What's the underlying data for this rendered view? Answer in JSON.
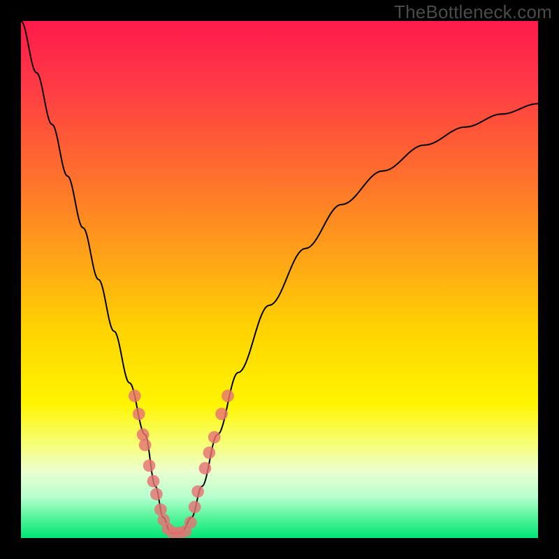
{
  "watermark": "TheBottleneck.com",
  "chart_data": {
    "type": "line",
    "title": "",
    "xlabel": "",
    "ylabel": "",
    "xlim": [
      0,
      100
    ],
    "ylim": [
      0,
      100
    ],
    "background_gradient": {
      "stops": [
        {
          "offset": 0.0,
          "color": "#ff1a4b"
        },
        {
          "offset": 0.12,
          "color": "#ff3945"
        },
        {
          "offset": 0.28,
          "color": "#ff6a2f"
        },
        {
          "offset": 0.44,
          "color": "#ff9e1a"
        },
        {
          "offset": 0.6,
          "color": "#ffd400"
        },
        {
          "offset": 0.74,
          "color": "#fff500"
        },
        {
          "offset": 0.82,
          "color": "#f6ff7a"
        },
        {
          "offset": 0.87,
          "color": "#ecffcf"
        },
        {
          "offset": 0.92,
          "color": "#b8ffcf"
        },
        {
          "offset": 0.96,
          "color": "#55f59a"
        },
        {
          "offset": 1.0,
          "color": "#00e676"
        }
      ]
    },
    "series": [
      {
        "name": "bottleneck-curve",
        "x": [
          0,
          3,
          6,
          9,
          12,
          15,
          18,
          21,
          24,
          26,
          27.5,
          29,
          31,
          33,
          35,
          38,
          42,
          48,
          55,
          62,
          70,
          78,
          86,
          93,
          100
        ],
        "values": [
          100,
          90,
          80,
          70,
          60,
          50,
          40,
          30,
          20,
          10,
          4,
          1,
          1,
          4,
          10,
          20,
          32,
          45,
          56,
          64.5,
          71,
          76,
          79.5,
          82,
          84
        ]
      }
    ],
    "markers": {
      "name": "highlight-points",
      "color": "#e57373",
      "radius_pct": 1.2,
      "points": [
        {
          "x": 22.0,
          "y": 27.5
        },
        {
          "x": 22.8,
          "y": 24.0
        },
        {
          "x": 23.6,
          "y": 20.0
        },
        {
          "x": 24.0,
          "y": 18.0
        },
        {
          "x": 24.8,
          "y": 14.0
        },
        {
          "x": 25.6,
          "y": 11.0
        },
        {
          "x": 26.2,
          "y": 8.5
        },
        {
          "x": 27.0,
          "y": 5.5
        },
        {
          "x": 27.6,
          "y": 3.5
        },
        {
          "x": 28.4,
          "y": 1.8
        },
        {
          "x": 29.4,
          "y": 1.0
        },
        {
          "x": 30.6,
          "y": 1.0
        },
        {
          "x": 31.8,
          "y": 1.3
        },
        {
          "x": 32.8,
          "y": 3.0
        },
        {
          "x": 33.6,
          "y": 6.0
        },
        {
          "x": 34.2,
          "y": 9.0
        },
        {
          "x": 35.6,
          "y": 13.5
        },
        {
          "x": 36.4,
          "y": 16.5
        },
        {
          "x": 37.4,
          "y": 19.5
        },
        {
          "x": 38.8,
          "y": 24.0
        },
        {
          "x": 40.0,
          "y": 27.5
        }
      ]
    }
  }
}
